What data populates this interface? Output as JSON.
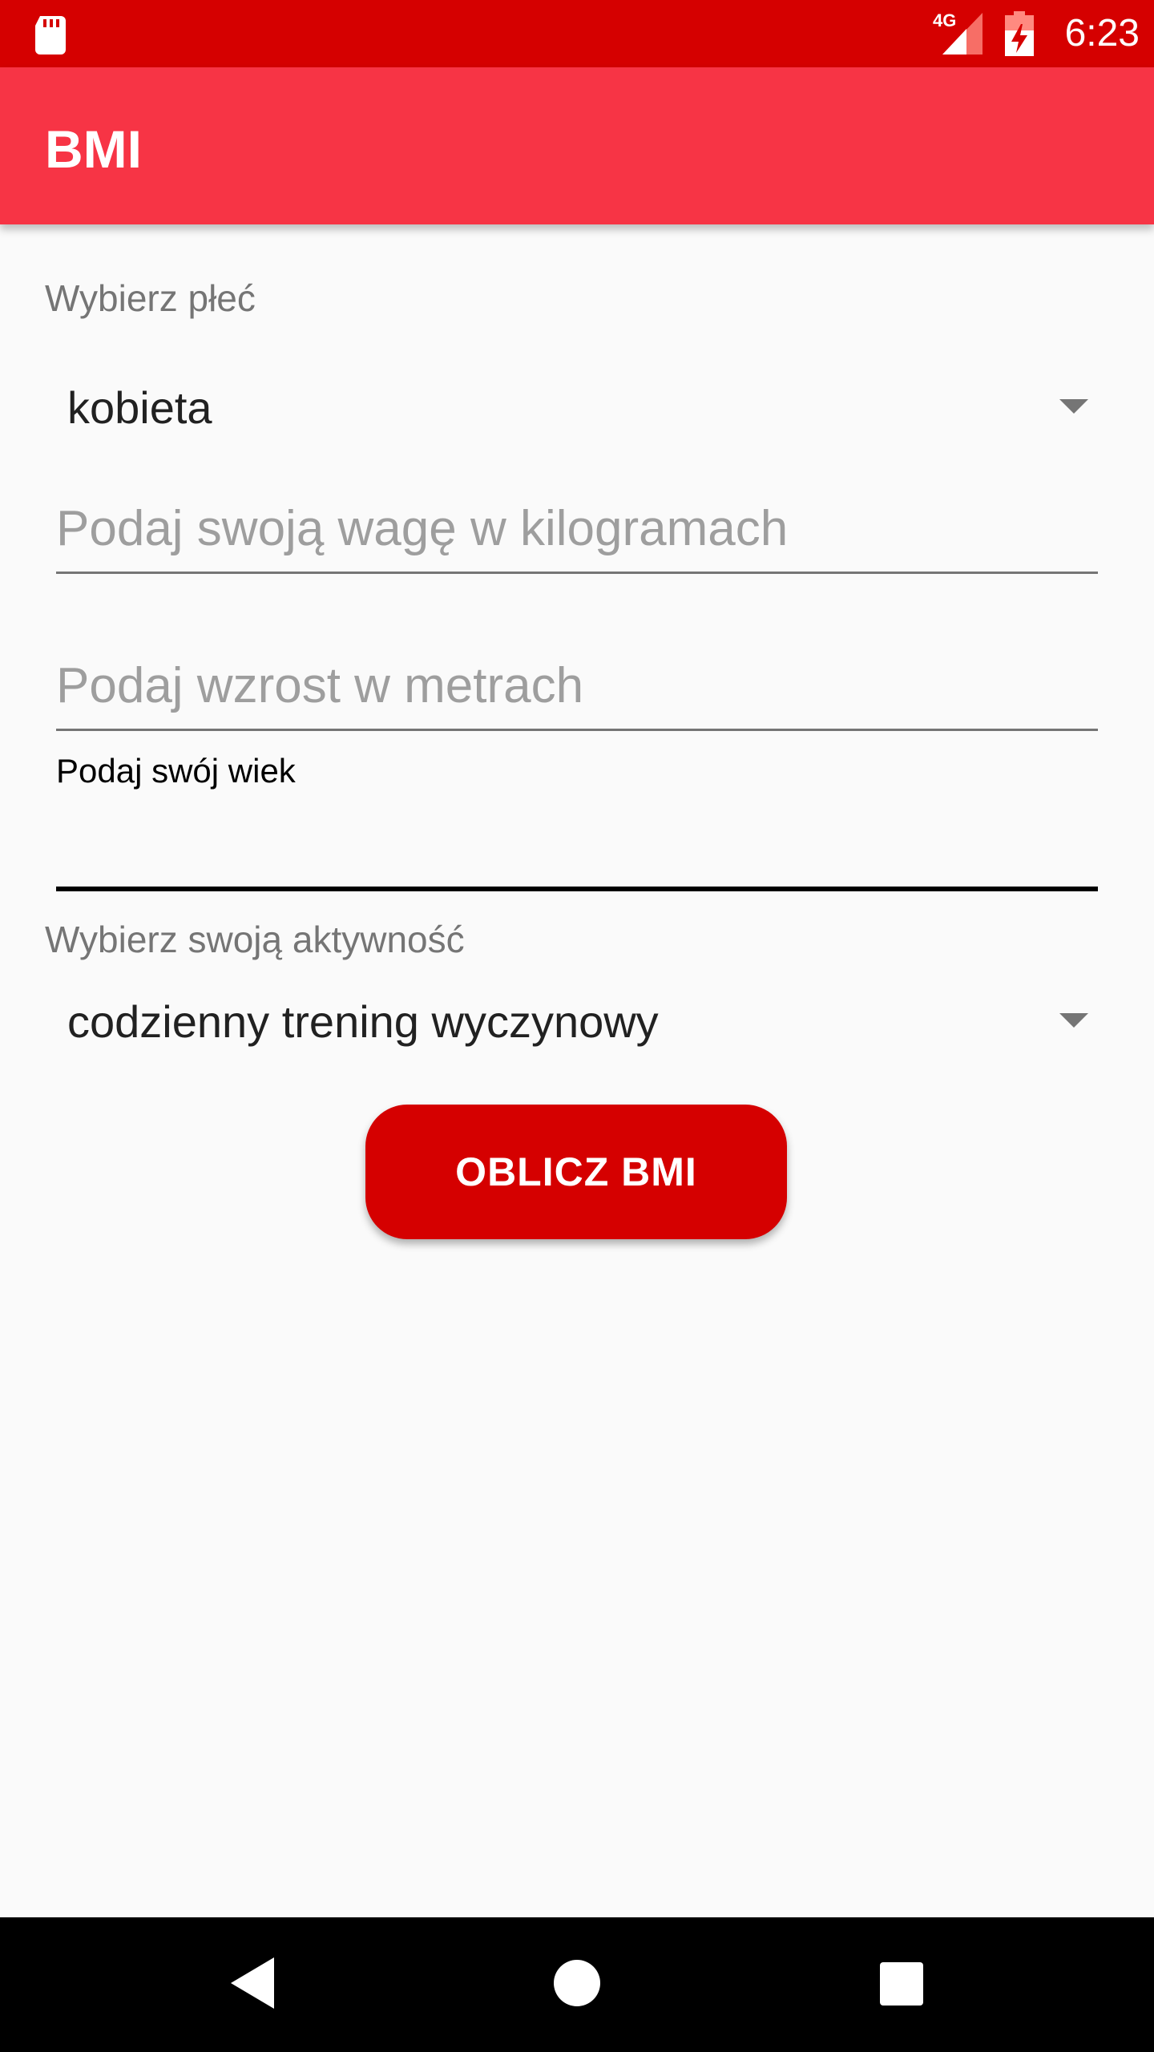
{
  "status_bar": {
    "network_type": "4G",
    "time": "6:23",
    "icons": [
      "sd-card-icon",
      "signal-icon",
      "battery-charging-icon"
    ]
  },
  "app_bar": {
    "title": "BMI"
  },
  "form": {
    "gender_label": "Wybierz płeć",
    "gender_selected": "kobieta",
    "weight_placeholder": "Podaj swoją wagę w kilogramach",
    "weight_value": "",
    "height_placeholder": "Podaj wzrost w metrach",
    "height_value": "",
    "age_label": "Podaj swój wiek",
    "age_value": "",
    "activity_label": "Wybierz swoją aktywność",
    "activity_selected": "codzienny trening wyczynowy",
    "calculate_button": "OBLICZ BMI"
  },
  "nav_bar": {
    "icons": [
      "back-icon",
      "home-icon",
      "recents-icon"
    ]
  },
  "colors": {
    "status_bar": "#d50000",
    "app_bar": "#f73445",
    "accent": "#d50000",
    "background": "#fafafa"
  }
}
